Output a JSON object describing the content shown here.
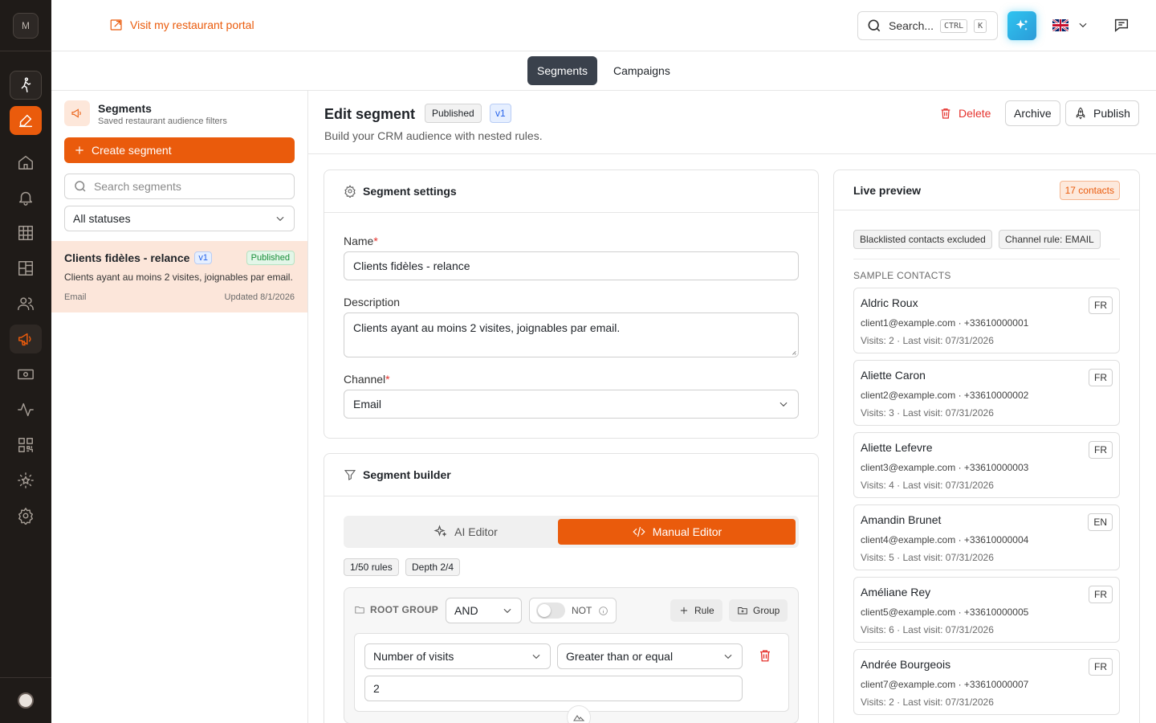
{
  "rail": {
    "avatar_initial": "M",
    "items": [
      "walk-icon",
      "edit-icon",
      "home-icon",
      "bell-icon",
      "grid-icon",
      "layout-icon",
      "users-icon",
      "megaphone-icon",
      "money-icon",
      "activity-icon",
      "qr-icon",
      "star-icon",
      "settings-icon"
    ]
  },
  "topbar": {
    "portal_link": "Visit my restaurant portal",
    "search_label": "Search...",
    "kbd_ctrl": "CTRL",
    "kbd_k": "K"
  },
  "tabs": [
    {
      "label": "Segments",
      "active": true
    },
    {
      "label": "Campaigns",
      "active": false
    }
  ],
  "sidebar": {
    "title": "Segments",
    "subtitle": "Saved restaurant audience filters",
    "create_label": "Create segment",
    "search_placeholder": "Search segments",
    "status_filter": "All statuses",
    "segments": [
      {
        "name": "Clients fidèles - relance",
        "version": "v1",
        "status": "Published",
        "description": "Clients ayant au moins 2 visites, joignables par email.",
        "channel": "Email",
        "updated": "Updated 8/1/2026"
      }
    ]
  },
  "header": {
    "title": "Edit segment",
    "status": "Published",
    "version": "v1",
    "subtitle": "Build your CRM audience with nested rules.",
    "delete_label": "Delete",
    "archive_label": "Archive",
    "publish_label": "Publish"
  },
  "settings": {
    "title": "Segment settings",
    "name_label": "Name",
    "name_value": "Clients fidèles - relance",
    "description_label": "Description",
    "description_value": "Clients ayant au moins 2 visites, joignables par email.",
    "channel_label": "Channel",
    "channel_value": "Email"
  },
  "builder": {
    "title": "Segment builder",
    "ai_editor": "AI Editor",
    "manual_editor": "Manual Editor",
    "rules_chip": "1/50 rules",
    "depth_chip": "Depth 2/4",
    "root_group_label": "ROOT GROUP",
    "operator": "AND",
    "not_label": "NOT",
    "add_rule": "Rule",
    "add_group": "Group",
    "rule": {
      "field": "Number of visits",
      "comparator": "Greater than or equal",
      "value": "2"
    }
  },
  "preview": {
    "title": "Live preview",
    "count": "17 contacts",
    "tags": [
      "Blacklisted contacts excluded",
      "Channel rule: EMAIL"
    ],
    "sample_title": "SAMPLE CONTACTS",
    "contacts": [
      {
        "name": "Aldric Roux",
        "lang": "FR",
        "contact": "client1@example.com · +33610000001",
        "visits": "Visits: 2 · Last visit: 07/31/2026"
      },
      {
        "name": "Aliette Caron",
        "lang": "FR",
        "contact": "client2@example.com · +33610000002",
        "visits": "Visits: 3 · Last visit: 07/31/2026"
      },
      {
        "name": "Aliette Lefevre",
        "lang": "FR",
        "contact": "client3@example.com · +33610000003",
        "visits": "Visits: 4 · Last visit: 07/31/2026"
      },
      {
        "name": "Amandin Brunet",
        "lang": "EN",
        "contact": "client4@example.com · +33610000004",
        "visits": "Visits: 5 · Last visit: 07/31/2026"
      },
      {
        "name": "Améliane Rey",
        "lang": "FR",
        "contact": "client5@example.com · +33610000005",
        "visits": "Visits: 6 · Last visit: 07/31/2026"
      },
      {
        "name": "Andrée Bourgeois",
        "lang": "FR",
        "contact": "client7@example.com · +33610000007",
        "visits": "Visits: 2 · Last visit: 07/31/2026"
      }
    ]
  },
  "colors": {
    "accent": "#ea5b0c",
    "rail_bg": "#1f1b18",
    "tab_active": "#3a414c",
    "danger": "#e5322d"
  }
}
